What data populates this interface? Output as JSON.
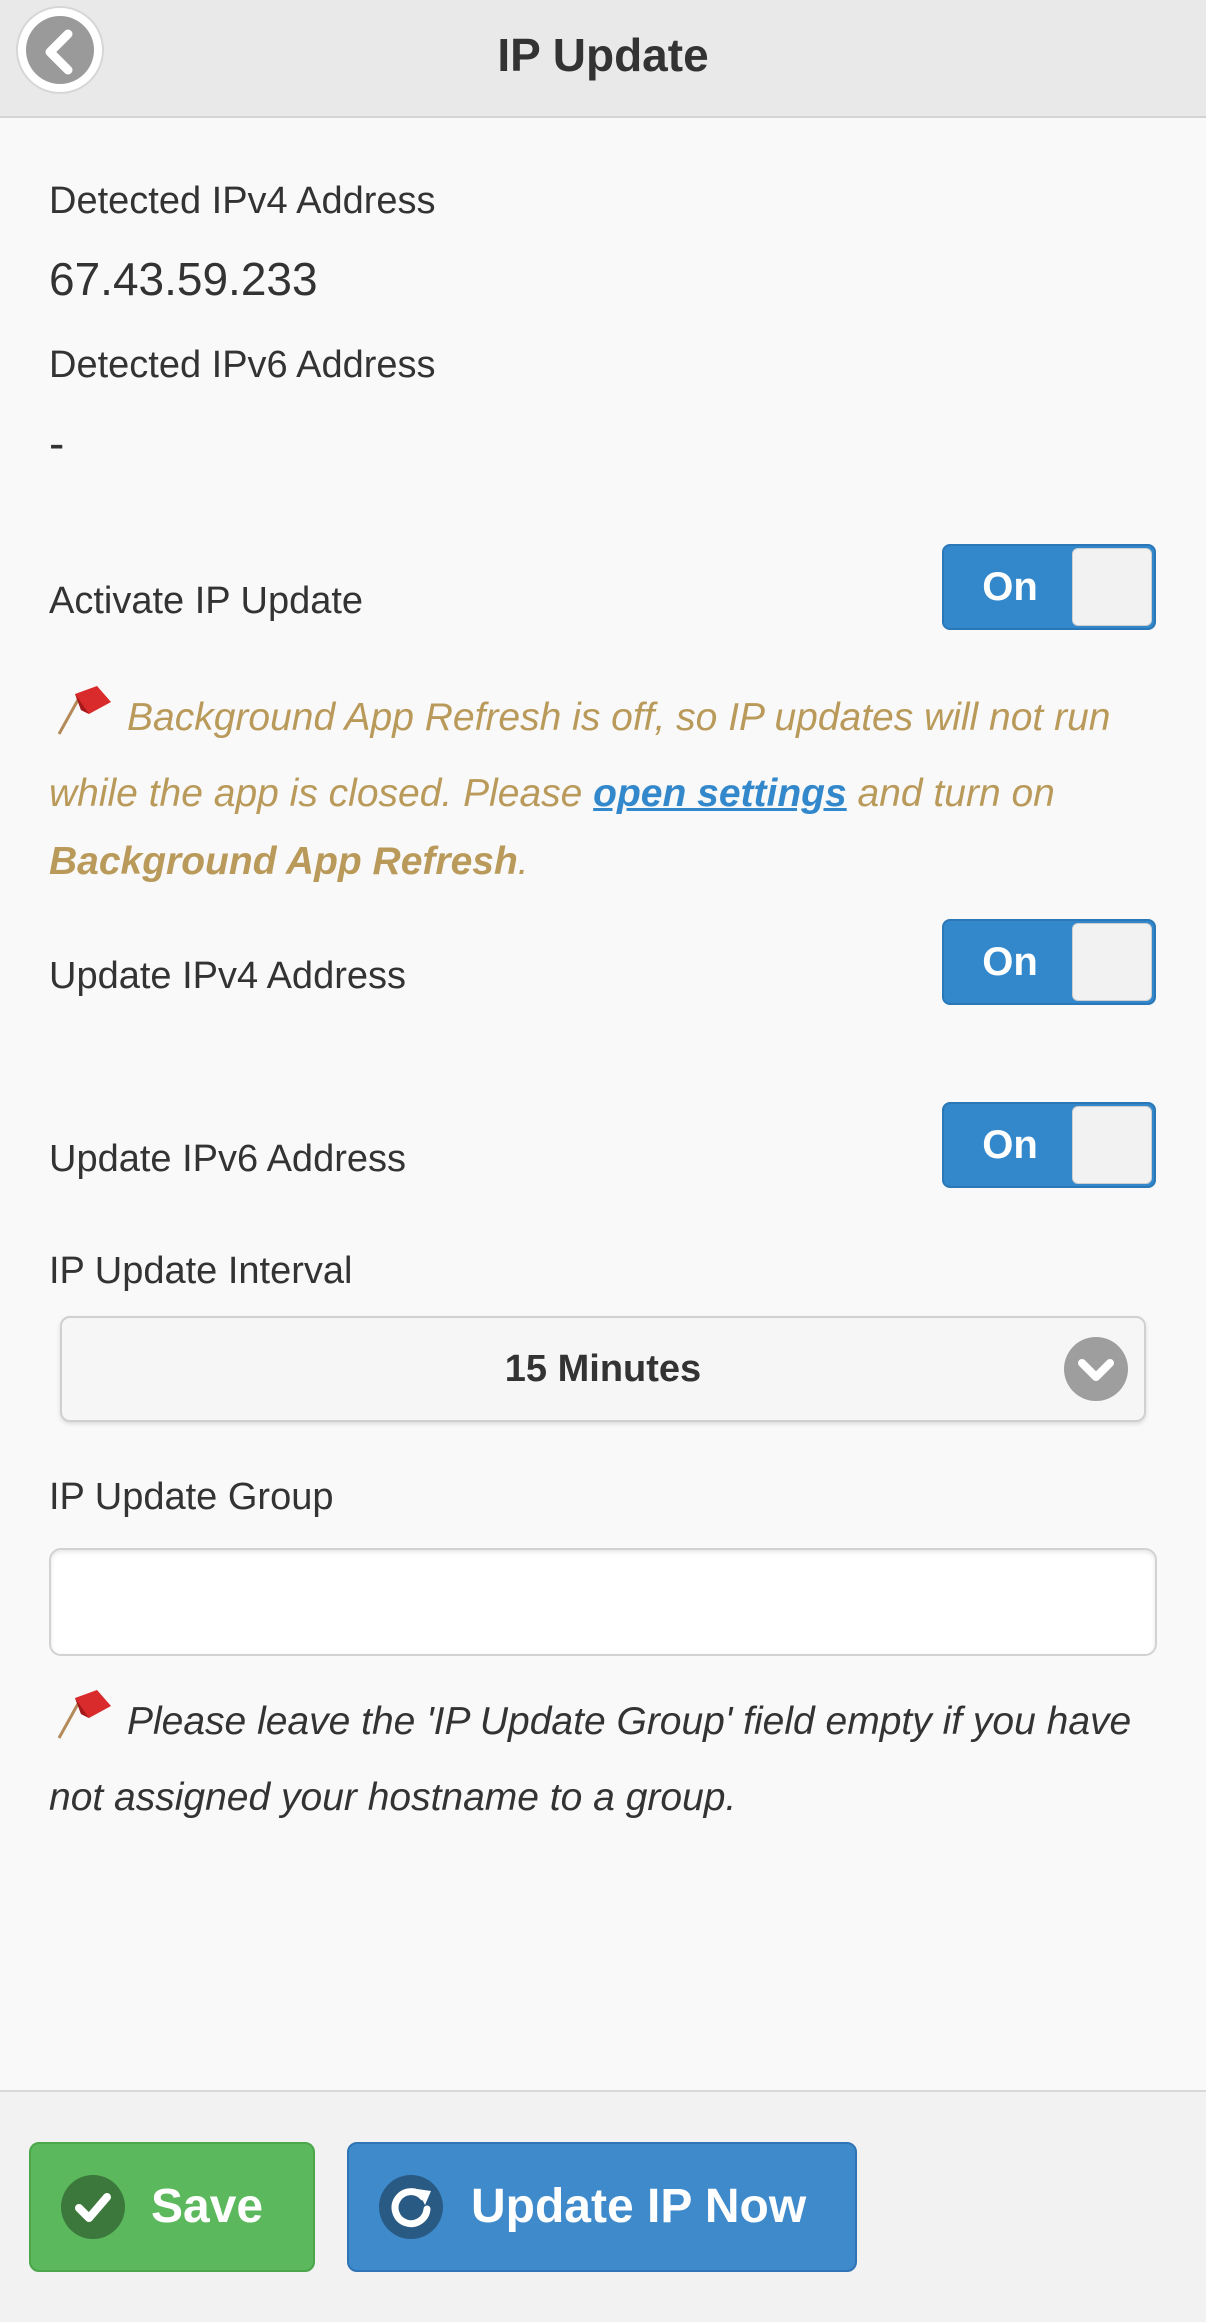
{
  "header": {
    "title": "IP Update",
    "back_icon": "chevron-left-icon"
  },
  "detected": {
    "ipv4_label": "Detected IPv4 Address",
    "ipv4_value": "67.43.59.233",
    "ipv6_label": "Detected IPv6 Address",
    "ipv6_value": "-"
  },
  "activate": {
    "label": "Activate IP Update",
    "toggle": "On"
  },
  "warning": {
    "text_before": "Background App Refresh is off, so IP updates will not run while the app is closed. Please ",
    "link": "open settings",
    "text_middle": " and turn on ",
    "bold": "Background App Refresh",
    "text_after": ".",
    "icon": "red-flag-icon",
    "color": "#b99a5a"
  },
  "update_ipv4": {
    "label": "Update IPv4 Address",
    "toggle": "On"
  },
  "update_ipv6": {
    "label": "Update IPv6 Address",
    "toggle": "On"
  },
  "interval": {
    "label": "IP Update Interval",
    "selected": "15 Minutes"
  },
  "group": {
    "label": "IP Update Group",
    "value": "",
    "placeholder": ""
  },
  "info": {
    "text": "Please leave the 'IP Update Group' field empty if you have not assigned your hostname to a group.",
    "icon": "red-flag-icon"
  },
  "footer": {
    "save_label": "Save",
    "update_label": "Update IP Now",
    "save_color": "#5cb85c",
    "update_color": "#3f8acb"
  },
  "colors": {
    "accent": "#3388cc",
    "warning": "#b99a5a"
  }
}
